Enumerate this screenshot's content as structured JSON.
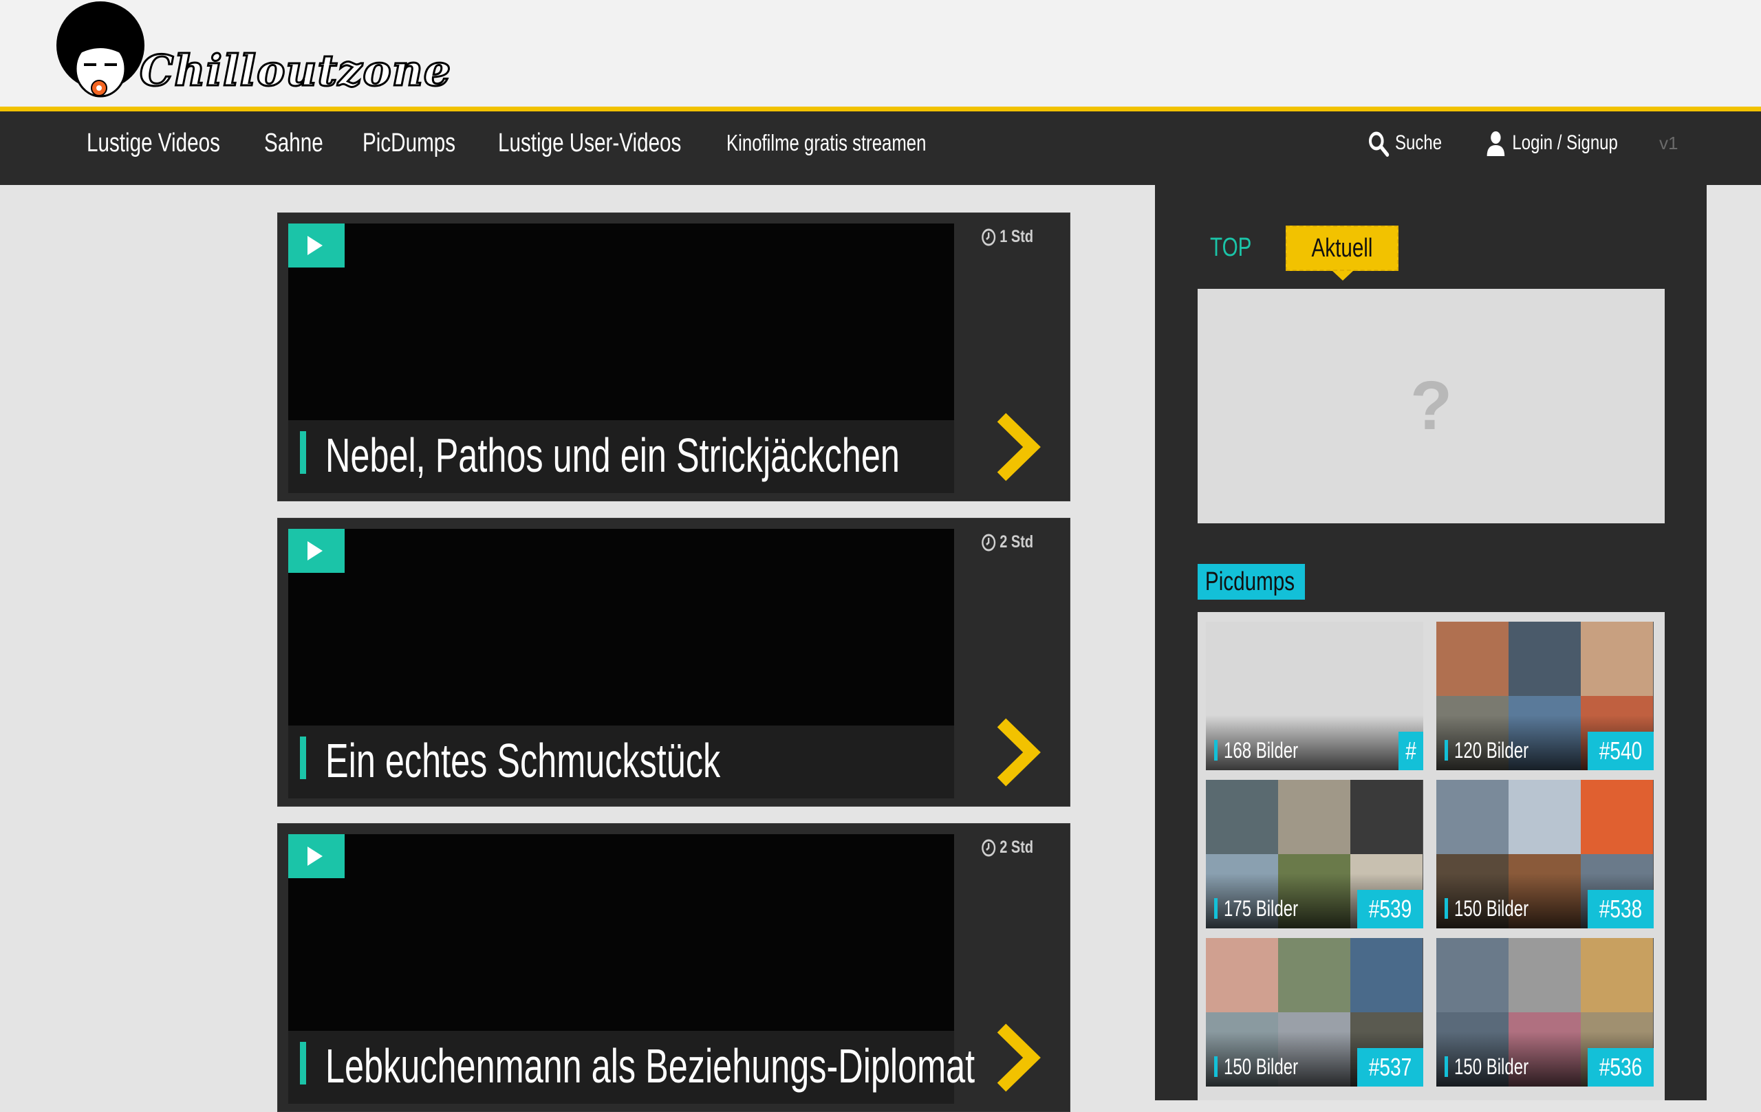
{
  "header": {
    "logo_text": "Chilloutzone",
    "nav": [
      {
        "label": "Lustige Videos"
      },
      {
        "label": "Sahne"
      },
      {
        "label": "PicDumps"
      },
      {
        "label": "Lustige User-Videos"
      },
      {
        "label": "Kinofilme gratis streamen"
      }
    ],
    "search_label": "Suche",
    "login_label": "Login / Signup",
    "version": "v1"
  },
  "feed": [
    {
      "title": "Nebel, Pathos und ein Strickjäckchen",
      "time": "1 Std"
    },
    {
      "title": "Ein echtes Schmuckstück",
      "time": "2 Std"
    },
    {
      "title": "Lebkuchenmann als Beziehungs-Diplomat",
      "time": "2 Std"
    }
  ],
  "sidebar": {
    "tabs": [
      "TOP",
      "Aktuell"
    ],
    "active_tab": "Aktuell",
    "placeholder": "?",
    "section_title": "Picdumps",
    "picdumps": [
      {
        "count": "168 Bilder",
        "number": "#"
      },
      {
        "count": "120 Bilder",
        "number": "#540"
      },
      {
        "count": "175 Bilder",
        "number": "#539"
      },
      {
        "count": "150 Bilder",
        "number": "#538"
      },
      {
        "count": "150 Bilder",
        "number": "#537"
      },
      {
        "count": "150 Bilder",
        "number": "#536"
      }
    ]
  },
  "colors": {
    "accent_yellow": "#f2c200",
    "accent_teal": "#1bc4a8",
    "accent_cyan": "#13c0d8",
    "nav_bg": "#2b2b2b"
  }
}
